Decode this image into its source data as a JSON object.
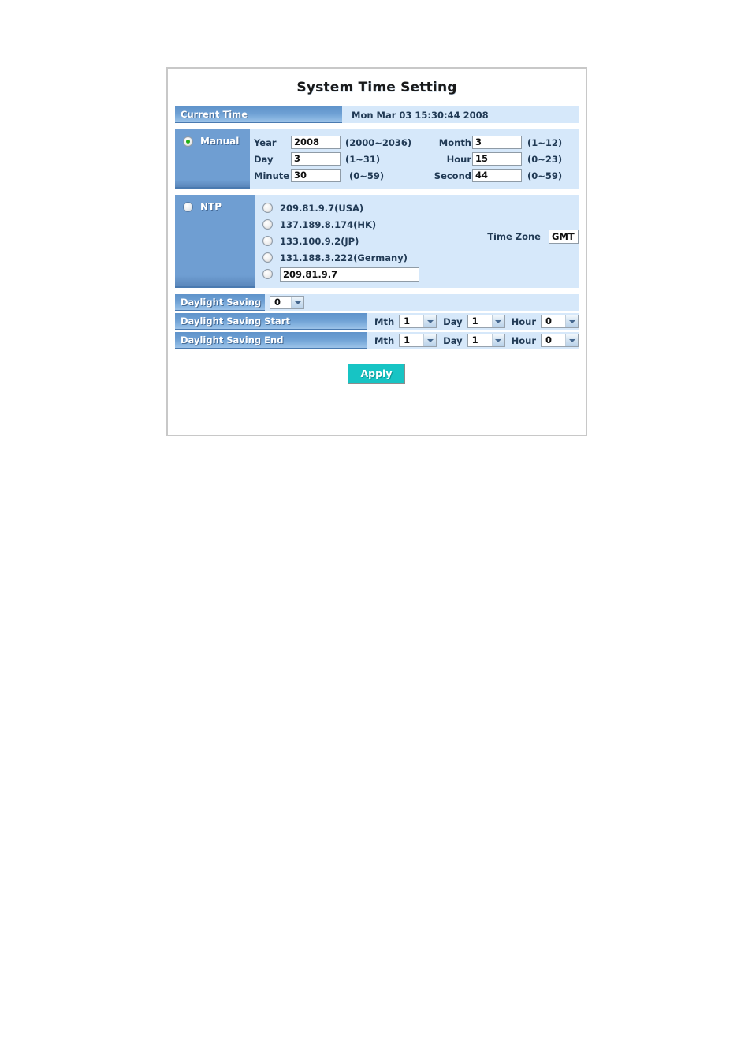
{
  "page": {
    "title": "System Time Setting"
  },
  "current_time": {
    "label": "Current Time",
    "value": "Mon Mar 03 15:30:44 2008"
  },
  "manual": {
    "mode_label": "Manual",
    "selected": true,
    "fields": {
      "year": {
        "label": "Year",
        "value": "2008",
        "range": "(2000~2036)"
      },
      "month": {
        "label": "Month",
        "value": "3",
        "range": "(1~12)"
      },
      "day": {
        "label": "Day",
        "value": "3",
        "range": "(1~31)"
      },
      "hour": {
        "label": "Hour",
        "value": "15",
        "range": "(0~23)"
      },
      "minute": {
        "label": "Minute",
        "value": "30",
        "range": "(0~59)"
      },
      "second": {
        "label": "Second",
        "value": "44",
        "range": "(0~59)"
      }
    }
  },
  "ntp": {
    "mode_label": "NTP",
    "selected": false,
    "servers": [
      {
        "label": "209.81.9.7(USA)",
        "selected": false
      },
      {
        "label": "137.189.8.174(HK)",
        "selected": false
      },
      {
        "label": "133.100.9.2(JP)",
        "selected": false
      },
      {
        "label": "131.188.3.222(Germany)",
        "selected": false
      }
    ],
    "custom": {
      "selected": false,
      "value": "209.81.9.7"
    },
    "time_zone": {
      "label": "Time Zone",
      "value": "GMT"
    }
  },
  "daylight_saving": {
    "label": "Daylight Saving",
    "value": "0",
    "start": {
      "label": "Daylight Saving Start",
      "month_label": "Mth",
      "month_value": "1",
      "day_label": "Day",
      "day_value": "1",
      "hour_label": "Hour",
      "hour_value": "0"
    },
    "end": {
      "label": "Daylight Saving End",
      "month_label": "Mth",
      "month_value": "1",
      "day_label": "Day",
      "day_value": "1",
      "hour_label": "Hour",
      "hour_value": "0"
    }
  },
  "apply": {
    "label": "Apply"
  },
  "colors": {
    "panel_bg": "#d6e8fa",
    "bar_blue": "#6f9ed2",
    "text_dark_blue": "#213a55",
    "apply_teal": "#17c4c4",
    "radio_green": "#22b014"
  }
}
